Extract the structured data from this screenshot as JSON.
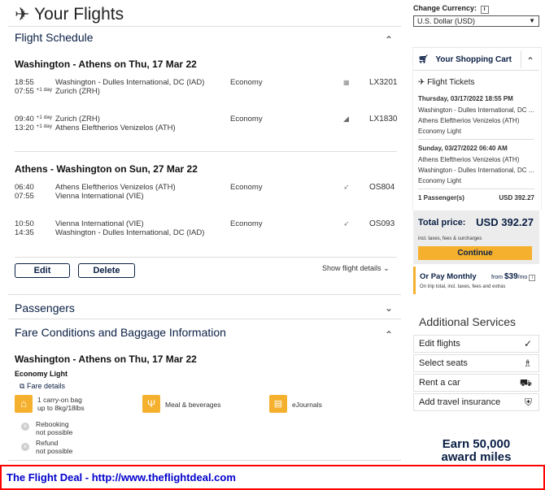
{
  "header": {
    "title": "Your Flights",
    "plane_icon": "airplane-icon"
  },
  "currency": {
    "label": "Change Currency:",
    "info": "i",
    "selected": "U.S. Dollar (USD)"
  },
  "schedule": {
    "title": "Flight Schedule",
    "outbound": {
      "heading": "Washington - Athens on Thu, 17 Mar 22",
      "legs": [
        {
          "dep_time": "18:55",
          "dep_sup": "",
          "arr_time": "07:55",
          "arr_sup": "+1 day",
          "from": "Washington - Dulles International, DC (IAD)",
          "to": "Zurich (ZRH)",
          "cabin": "Economy",
          "flight": "LX3201"
        },
        {
          "dep_time": "09:40",
          "dep_sup": "+1 day",
          "arr_time": "13:20",
          "arr_sup": "+1 day",
          "from": "Zurich (ZRH)",
          "to": "Athens Eleftherios Venizelos (ATH)",
          "cabin": "Economy",
          "flight": "LX1830"
        }
      ]
    },
    "inbound": {
      "heading": "Athens - Washington on Sun, 27 Mar 22",
      "legs": [
        {
          "dep_time": "06:40",
          "arr_time": "07:55",
          "from": "Athens Eleftherios Venizelos (ATH)",
          "to": "Vienna International (VIE)",
          "cabin": "Economy",
          "flight": "OS804"
        },
        {
          "dep_time": "10:50",
          "arr_time": "14:35",
          "from": "Vienna International (VIE)",
          "to": "Washington - Dulles International, DC (IAD)",
          "cabin": "Economy",
          "flight": "OS093"
        }
      ]
    },
    "edit_label": "Edit",
    "delete_label": "Delete",
    "show_details": "Show flight details"
  },
  "passengers": {
    "title": "Passengers"
  },
  "fare": {
    "title": "Fare Conditions and Baggage Information",
    "heading": "Washington - Athens on Thu, 17 Mar 22",
    "fare_name": "Economy Light",
    "details_link": "Fare details",
    "bag_line1": "1 carry-on bag",
    "bag_line2": "up to 8kg/18lbs",
    "meal": "Meal & beverages",
    "journals": "eJournals",
    "rebook_line1": "Rebooking",
    "rebook_line2": "not possible",
    "refund_line1": "Refund",
    "refund_line2": "not possible"
  },
  "cart": {
    "title": "Your Shopping Cart",
    "section": "Flight Tickets",
    "out_date": "Thursday, 03/17/2022 18:55 PM",
    "out_from": "Washington - Dulles International, DC ...",
    "out_to": "Athens Eleftherios Venizelos (ATH)",
    "out_fare": "Economy Light",
    "in_date": "Sunday, 03/27/2022 06:40 AM",
    "in_from": "Athens Eleftherios Venizelos (ATH)",
    "in_to": "Washington - Dulles International, DC ...",
    "in_fare": "Economy Light",
    "passengers": "1 Passenger(s)",
    "pass_price": "USD 392.27",
    "total_label": "Total price:",
    "total_value": "USD 392.27",
    "taxes_note": "incl. taxes, fees & surcharges",
    "continue_label": "Continue",
    "monthly_title": "Or Pay Monthly",
    "monthly_from": "from",
    "monthly_amount": "$39",
    "monthly_per": "/mo",
    "monthly_note": "On trip total, incl. taxes, fees and extras"
  },
  "services": {
    "title": "Additional Services",
    "items": [
      {
        "label": "Edit flights",
        "icon": "checkmark-icon"
      },
      {
        "label": "Select seats",
        "icon": "seat-icon"
      },
      {
        "label": "Rent a car",
        "icon": "car-icon"
      },
      {
        "label": "Add travel insurance",
        "icon": "shield-icon"
      }
    ]
  },
  "promo": {
    "line1": "Earn 50,000",
    "line2": "award miles"
  },
  "footer": {
    "text": "The Flight Deal - http://www.theflightdeal.com"
  },
  "colors": {
    "brand": "#0a1f44",
    "accent": "#f5b02e",
    "footer_border": "#ff0000",
    "footer_text": "#0000cc"
  }
}
